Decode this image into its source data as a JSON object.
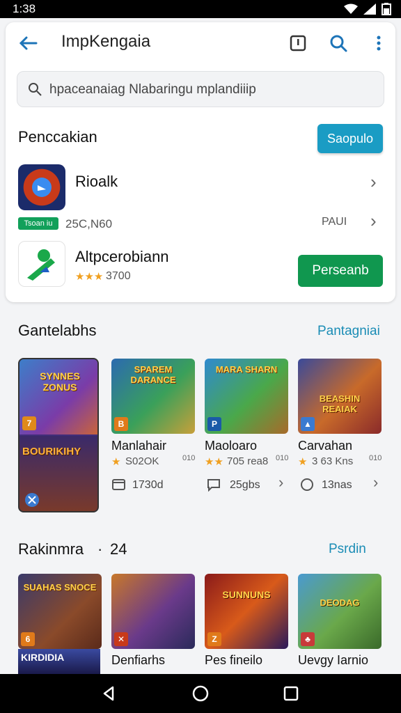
{
  "status": {
    "time": "1:38"
  },
  "appbar": {
    "title": "ImpKengaia"
  },
  "search": {
    "placeholder": "hpaceanaiag Nlabaringu mplandiiip"
  },
  "top_section": {
    "title": "Penccakian",
    "action_label": "Saopulo",
    "rows": [
      {
        "name": "Rioalk",
        "badge": "Tsoan iu",
        "meta": "25C,N60",
        "right": "PAUI"
      },
      {
        "name": "Altpcerobiann",
        "rating": "3700",
        "button": "Perseanb"
      }
    ]
  },
  "section1": {
    "title": "Gantelabhs",
    "more": "Pantagniai",
    "featured": {
      "top_text": "SYNNES ZONUS",
      "bottom_text": "BOURIKIHY"
    },
    "games": [
      {
        "banner": "SPAREM DARANCE",
        "name": "Manlahair",
        "rating": "S02OK",
        "small": "010",
        "meta": "1730d"
      },
      {
        "banner": "MARA SHARN",
        "name": "Maoloaro",
        "rating": "705 rea8",
        "small": "010",
        "meta": "25gbs"
      },
      {
        "banner": "BEASHIN REAIAK",
        "name": "Carvahan",
        "rating": "3 63 Kns",
        "small": "010",
        "meta": "13nas"
      }
    ]
  },
  "section2": {
    "title": "Rakinmra",
    "count": "24",
    "more": "Psrdin",
    "games": [
      {
        "banner": "SUAHAS SNOCE",
        "name": "KIRDIDIA"
      },
      {
        "banner": "",
        "name": "Denfiarhs"
      },
      {
        "banner": "SUNNUNS",
        "name": "Pes fineilo"
      },
      {
        "banner": "DEODAG",
        "name": "Uevgy  Iarnio"
      }
    ]
  },
  "colors": {
    "accent": "#1a9cc4",
    "install": "#10974f",
    "link": "#1a8cb5"
  }
}
